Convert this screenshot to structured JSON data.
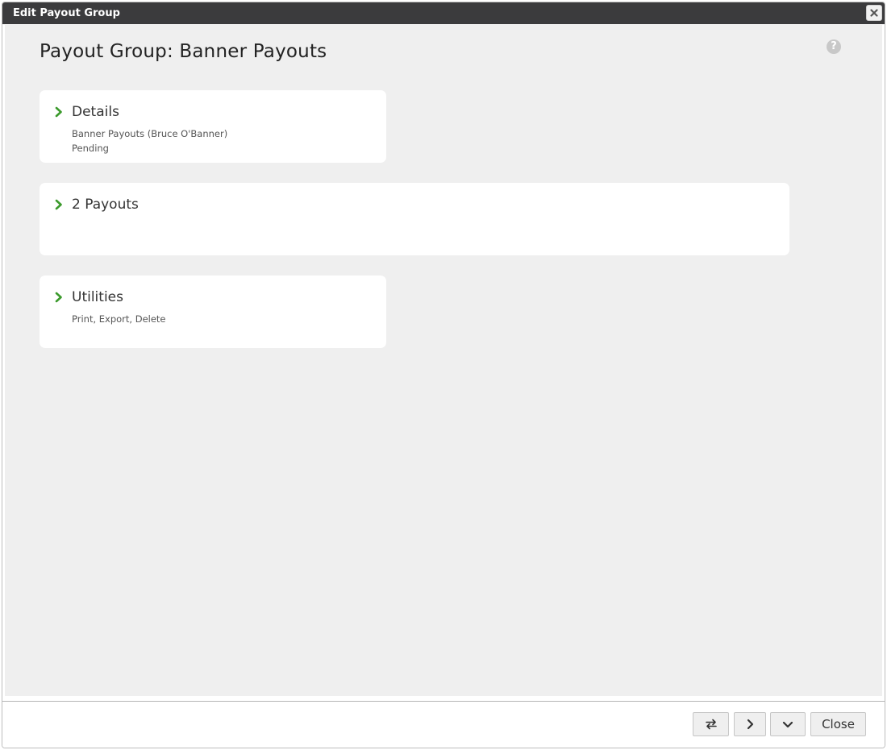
{
  "window": {
    "title": "Edit Payout Group"
  },
  "page": {
    "title": "Payout Group: Banner Payouts"
  },
  "cards": {
    "details": {
      "title": "Details",
      "line1": "Banner Payouts (Bruce O'Banner)",
      "line2": "Pending"
    },
    "payouts": {
      "title": "2 Payouts"
    },
    "utilities": {
      "title": "Utilities",
      "line1": "Print, Export, Delete"
    }
  },
  "footer": {
    "close_label": "Close"
  },
  "icons": {
    "close": "close-icon",
    "help": "question-circle-icon",
    "chevron": "chevron-right-icon",
    "swap": "swap-arrows-icon",
    "next": "chevron-right-icon",
    "expand": "chevron-down-icon"
  },
  "colors": {
    "titlebar": "#3b3b3d",
    "accent": "#3b9a2c",
    "background": "#efefef"
  }
}
